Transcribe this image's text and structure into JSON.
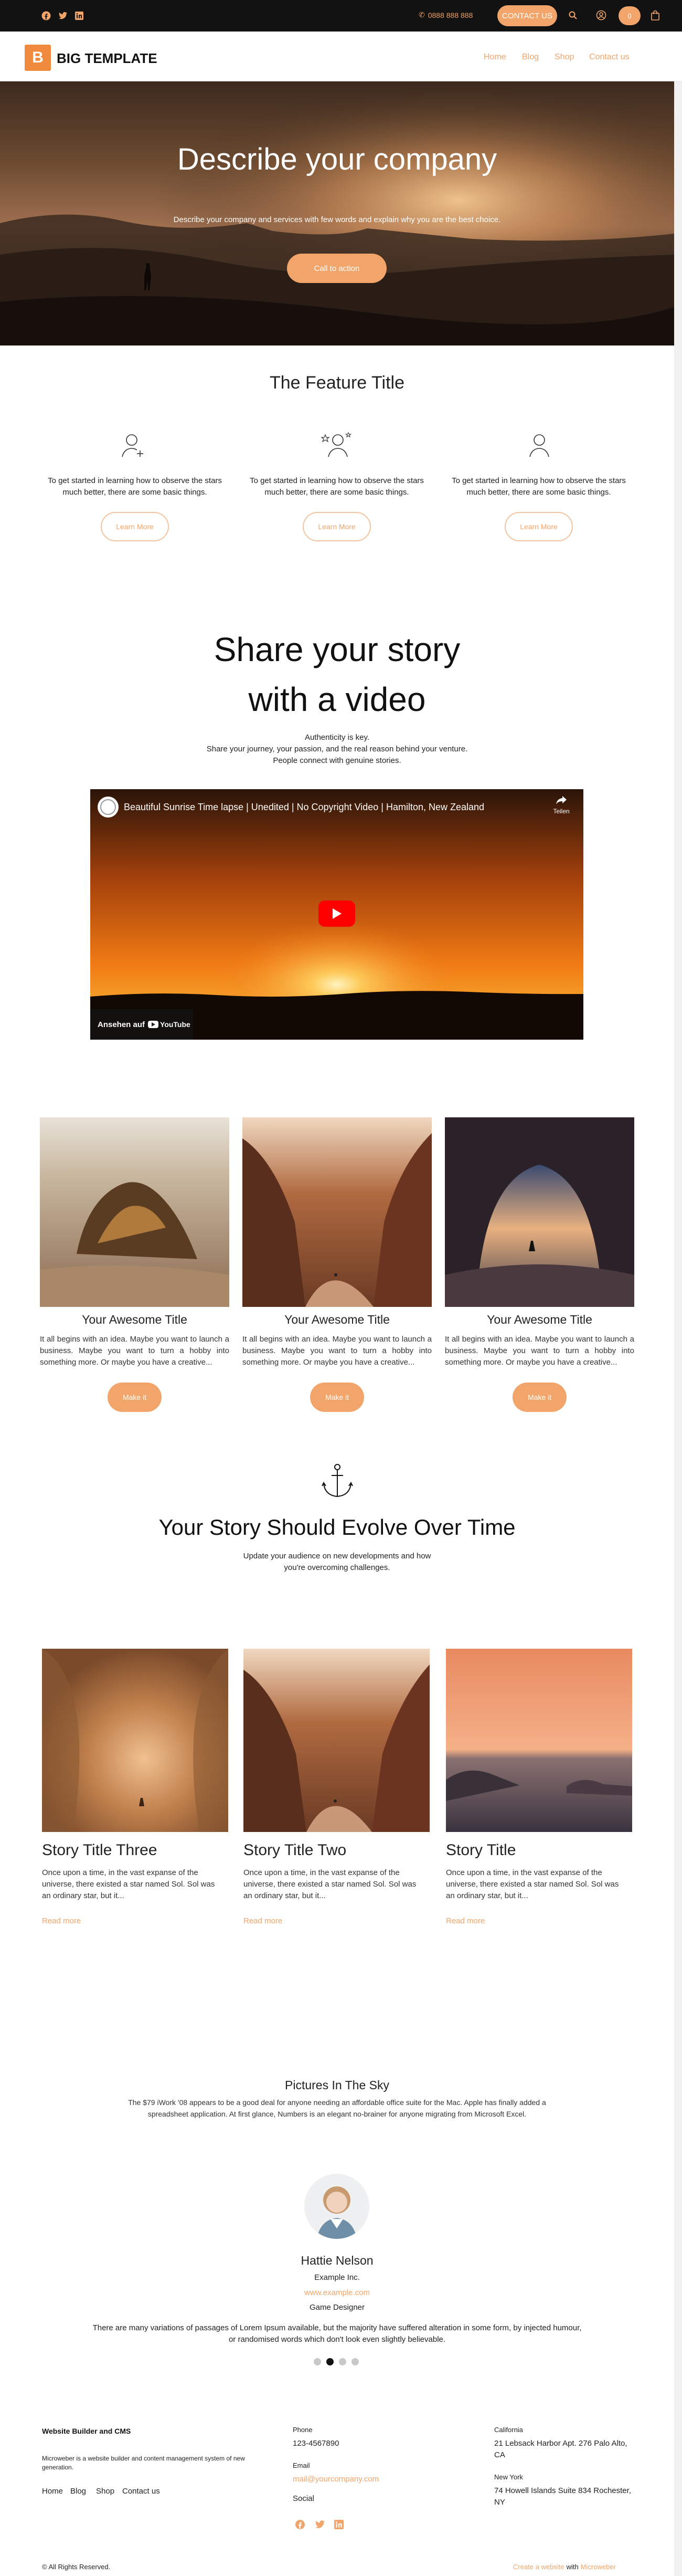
{
  "topbar": {
    "social_icons": [
      "facebook-icon",
      "twitter-icon",
      "linkedin-icon"
    ],
    "phone": "0888 888 888",
    "contact_label": "CONTACT US",
    "cart_count": "0"
  },
  "header": {
    "logo_letter": "B",
    "logo_text": "BIG TEMPLATE",
    "nav": [
      "Home",
      "Blog",
      "Shop",
      "Contact us"
    ]
  },
  "hero": {
    "title": "Describe your company",
    "subtitle": "Describe your company and services with few words and explain why you are the best choice.",
    "cta": "Call to action"
  },
  "features": {
    "title": "The Feature Title",
    "items": [
      {
        "icon": "user-add-icon",
        "text": "To get started in learning how to observe the stars much better, there are some basic things.",
        "button": "Learn More"
      },
      {
        "icon": "user-star-icon",
        "text": "To get started in learning how to observe the stars much better, there are some basic things.",
        "button": "Learn More"
      },
      {
        "icon": "user-icon",
        "text": "To get started in learning how to observe the stars much better, there are some basic things.",
        "button": "Learn More"
      }
    ]
  },
  "video_section": {
    "title_line1": "Share your story",
    "title_line2": "with a video",
    "line1": "Authenticity is key.",
    "line2": "Share your journey, your passion, and the real reason behind your venture.",
    "line3": "People connect with genuine stories.",
    "video_title": "Beautiful Sunrise Time lapse | Unedited | No Copyright Video | Hamilton, New Zealand",
    "share_label": "Teilen",
    "watch_label": "Ansehen auf",
    "youtube_label": "YouTube"
  },
  "cards": [
    {
      "title": "Your Awesome Title",
      "text": "It all begins with an idea. Maybe you want to launch a business. Maybe you want to turn a hobby into something more. Or maybe you have a creative...",
      "button": "Make it"
    },
    {
      "title": "Your Awesome Title",
      "text": "It all begins with an idea. Maybe you want to launch a business. Maybe you want to turn a hobby into something more. Or maybe you have a creative...",
      "button": "Make it"
    },
    {
      "title": "Your Awesome Title",
      "text": "It all begins with an idea. Maybe you want to launch a business. Maybe you want to turn a hobby into something more. Or maybe you have a creative...",
      "button": "Make it"
    }
  ],
  "evolve": {
    "title": "Your Story Should Evolve Over Time",
    "line1": "Update your audience on new developments and how",
    "line2": "you're overcoming challenges."
  },
  "stories": [
    {
      "title": "Story Title Three",
      "text": "Once upon a time, in the vast expanse of the universe, there existed a star named Sol. Sol was an ordinary star, but it...",
      "link": "Read more"
    },
    {
      "title": "Story Title Two",
      "text": "Once upon a time, in the vast expanse of the universe, there existed a star named Sol. Sol was an ordinary star, but it...",
      "link": "Read more"
    },
    {
      "title": "Story Title",
      "text": "Once upon a time, in the vast expanse of the universe, there existed a star named Sol. Sol was an ordinary star, but it...",
      "link": "Read more"
    }
  ],
  "testimonial": {
    "title": "Pictures In The Sky",
    "intro_line1": "The $79 iWork '08 appears to be a good deal for anyone needing an affordable office suite for the Mac. Apple has finally added a",
    "intro_line2": "spreadsheet application. At first glance, Numbers is an elegant no-brainer for anyone migrating from Microsoft Excel.",
    "name": "Hattie Nelson",
    "company": "Example Inc.",
    "website": "www.example.com",
    "role": "Game Designer",
    "quote_line1": "There are many variations of passages of Lorem Ipsum available, but the majority have suffered alteration in some form, by injected humour,",
    "quote_line2": "or randomised words which don't look even slightly believable.",
    "dots_active": 2
  },
  "footer": {
    "brand_title": "Website Builder and CMS",
    "brand_text_line1": "Microweber is a website builder and content management system of new",
    "brand_text_line2": "generation.",
    "links": [
      "Home",
      "Blog",
      "Shop",
      "Contact us"
    ],
    "phone_label": "Phone",
    "phone": "123-4567890",
    "email_label": "Email",
    "email": "mail@yourcompany.com",
    "social_label": "Social",
    "california_label": "California",
    "california_line1": "21 Lebsack Harbor Apt. 276 Palo Alto,",
    "california_line2": "CA",
    "newyork_label": "New York",
    "newyork_line1": "74 Howell Islands Suite 834 Rochester,",
    "newyork_line2": "NY",
    "copyright": "© All Rights Reserved.",
    "credit_link": "Create a website",
    "credit_with": "with",
    "credit_brand": "Microweber"
  },
  "colors": {
    "accent": "#f2a56a",
    "topbar": "#121212",
    "logo": "#f08a3c"
  }
}
